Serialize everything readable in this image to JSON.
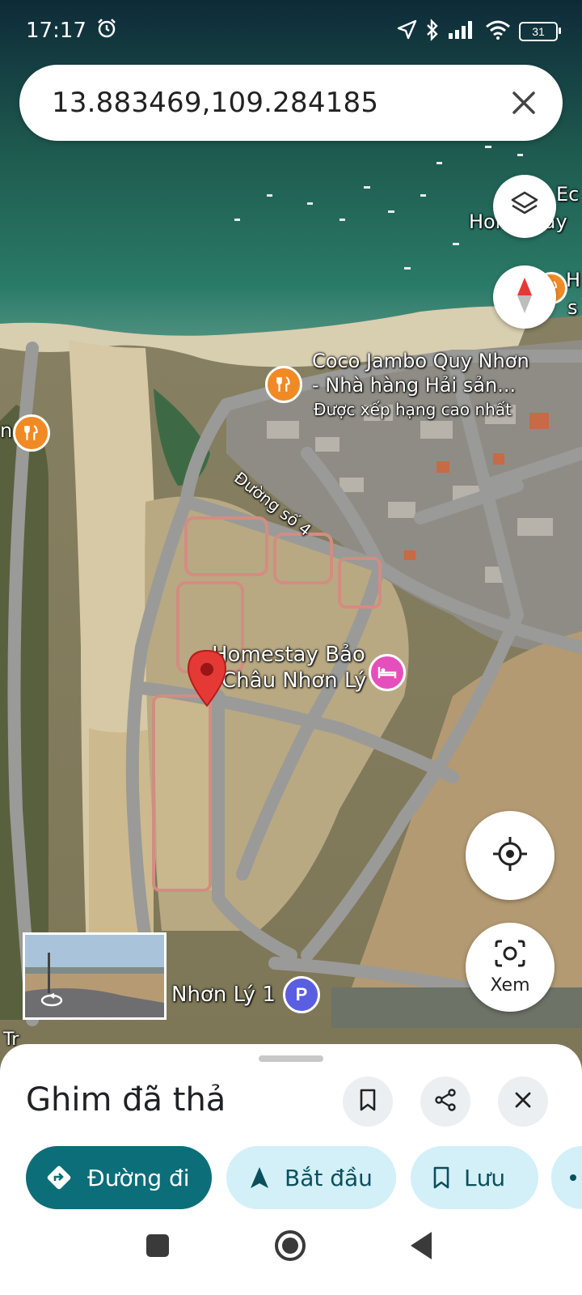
{
  "status_bar": {
    "time": "17:17",
    "battery": "31"
  },
  "search": {
    "value": "13.883469,109.284185"
  },
  "map_labels": {
    "coco_line1": "Coco Jambo Quy Nhơn",
    "coco_line2": "- Nhà hàng Hải sản...",
    "coco_rating": "Được xếp hạng cao nhất",
    "street": "Đường số 4",
    "homestay_line1": "Homestay Bảo",
    "homestay_line2": "Châu Nhơn Lý",
    "parking": "Nhơn Lý 1",
    "top_right_1": "Ec",
    "top_right_2": "Homestay",
    "right_edge_1": "H",
    "right_edge_2": "s",
    "left_edge": "n",
    "bottom_left": "Tr"
  },
  "buttons": {
    "view_label": "Xem"
  },
  "sheet": {
    "title": "Ghim đã thả",
    "chips": {
      "directions": "Đường đi",
      "start": "Bắt đầu",
      "save": "Lưu"
    }
  },
  "colors": {
    "primary": "#0b6e79",
    "chip_bg": "#d3f0f9",
    "poi_food": "#f08a24",
    "poi_hotel": "#e54fbc",
    "poi_parking": "#5a5ee0",
    "pin": "#e53935"
  }
}
